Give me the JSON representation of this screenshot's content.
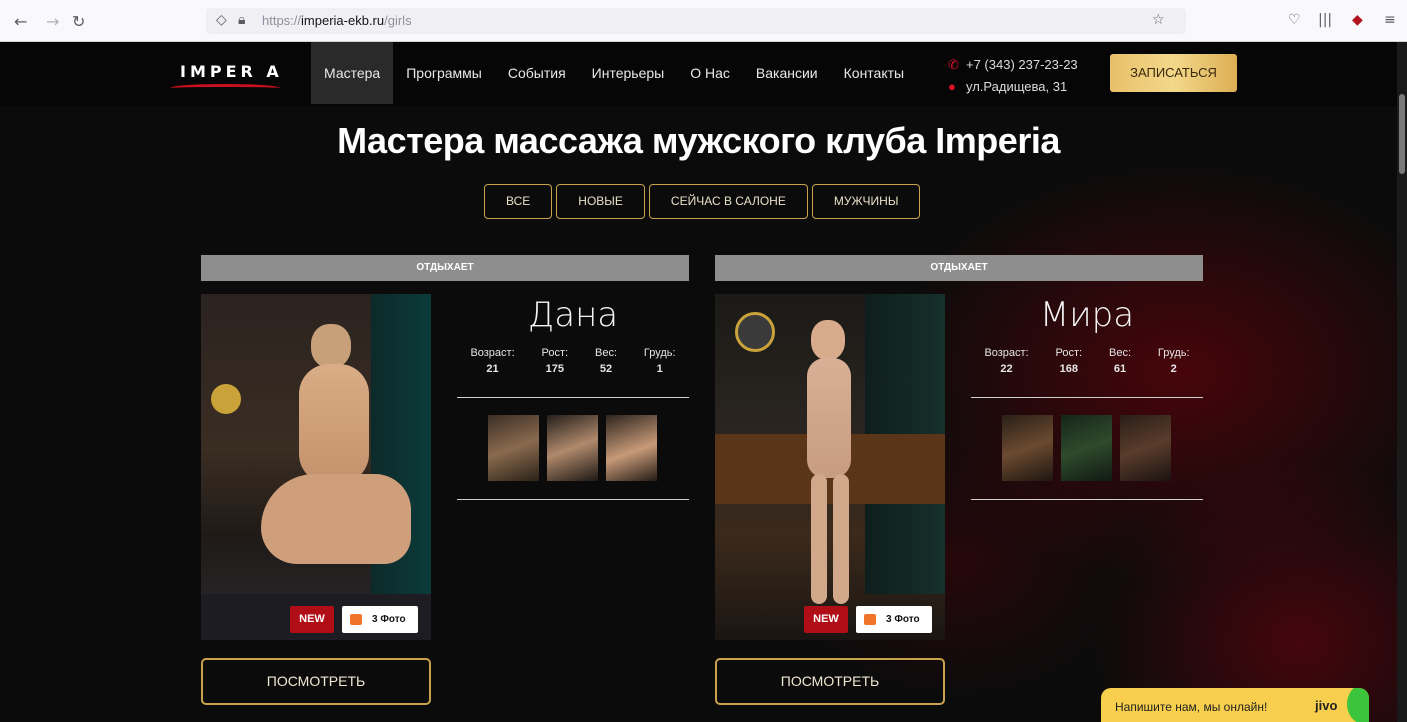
{
  "browser": {
    "url_prefix": "https://",
    "url_domain": "imperia-ekb.ru",
    "url_path": "/girls"
  },
  "header": {
    "logo_text": "IMPER A",
    "menu": [
      "Мастера",
      "Программы",
      "События",
      "Интерьеры",
      "О Нас",
      "Вакансии",
      "Контакты"
    ],
    "phone": "+7 (343) 237-23-23",
    "address": "ул.Радищева, 31",
    "signup_label": "ЗАПИСАТЬСЯ",
    "accent_color": "#c9a24e"
  },
  "main": {
    "title": "Мастера массажа мужского клуба Imperia",
    "filters": [
      "ВСЕ",
      "НОВЫЕ",
      "СЕЙЧАС В САЛОНЕ",
      "МУЖЧИНЫ"
    ]
  },
  "cards": [
    {
      "status": "ОТДЫХАЕТ",
      "name": "Дана",
      "stats": [
        {
          "label": "Возраст:",
          "value": "21"
        },
        {
          "label": "Рост:",
          "value": "175"
        },
        {
          "label": "Вес:",
          "value": "52"
        },
        {
          "label": "Грудь:",
          "value": "1"
        }
      ],
      "badge_new": "NEW",
      "badge_photos": "3 Фото",
      "view_label": "ПОСМОТРЕТЬ"
    },
    {
      "status": "ОТДЫХАЕТ",
      "name": "Мира",
      "stats": [
        {
          "label": "Возраст:",
          "value": "22"
        },
        {
          "label": "Рост:",
          "value": "168"
        },
        {
          "label": "Вес:",
          "value": "61"
        },
        {
          "label": "Грудь:",
          "value": "2"
        }
      ],
      "badge_new": "NEW",
      "badge_photos": "3 Фото",
      "view_label": "ПОСМОТРЕТЬ"
    }
  ],
  "chat": {
    "text": "Напишите нам, мы онлайн!",
    "brand": "jivo"
  }
}
